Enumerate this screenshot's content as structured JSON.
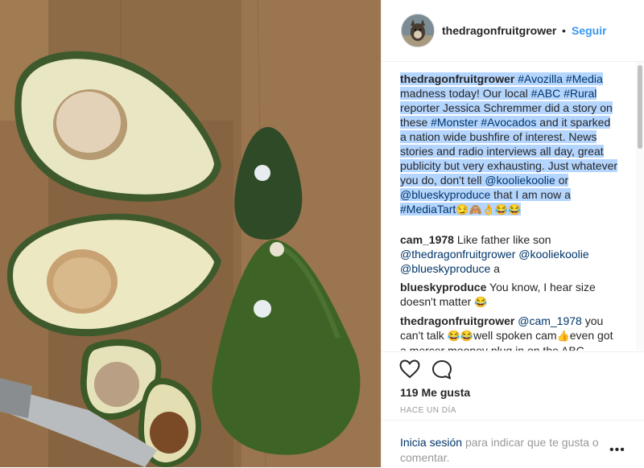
{
  "post": {
    "username": "thedragonfruitgrower",
    "dot": "•",
    "follow_label": "Seguir"
  },
  "caption": {
    "user": "thedragonfruitgrower",
    "tag1": "#Avozilla",
    "tag2": "#Media",
    "text1": "madness today! Our local",
    "tag3": "#ABC",
    "tag4": "#Rural",
    "text2": "reporter Jessica Schremmer did a story on these",
    "tag5": "#Monster",
    "tag6": "#Avocados",
    "text3": "and it sparked a nation wide bushfire of interest. News stories and radio interviews all day, great publicity but very exhausting. Just whatever you do, don't tell",
    "mention1": "@kooliekoolie",
    "text4": "or",
    "mention2": "@blueskyproduce",
    "text5": "that I am now a",
    "tag7": "#MediaTart",
    "emojis": "😏🙈👌😂😂"
  },
  "comments": [
    {
      "user": "cam_1978",
      "text1": "Like father like son",
      "mention1": "@thedragonfruitgrower",
      "mention2": "@kooliekoolie",
      "mention3": "@blueskyproduce",
      "text2": "a"
    },
    {
      "user": "blueskyproduce",
      "text": "You know, I hear size doesn't matter",
      "emoji": "😂"
    },
    {
      "user": "thedragonfruitgrower",
      "mention": "@cam_1978",
      "text1": "you can't talk",
      "emoji1": "😂😂",
      "text2": "well spoken cam",
      "emoji2": "👍",
      "text3": "even got a mercer mooney plug in on the ABC"
    }
  ],
  "likes_label": "119 Me gusta",
  "time_label": "HACE UN DÍA",
  "footer": {
    "login_label": "Inicia sesión",
    "rest_label": "para indicar que te gusta o comentar.",
    "more_label": "•••"
  },
  "icons": [
    "heart-icon",
    "comment-icon",
    "more-options-icon"
  ]
}
